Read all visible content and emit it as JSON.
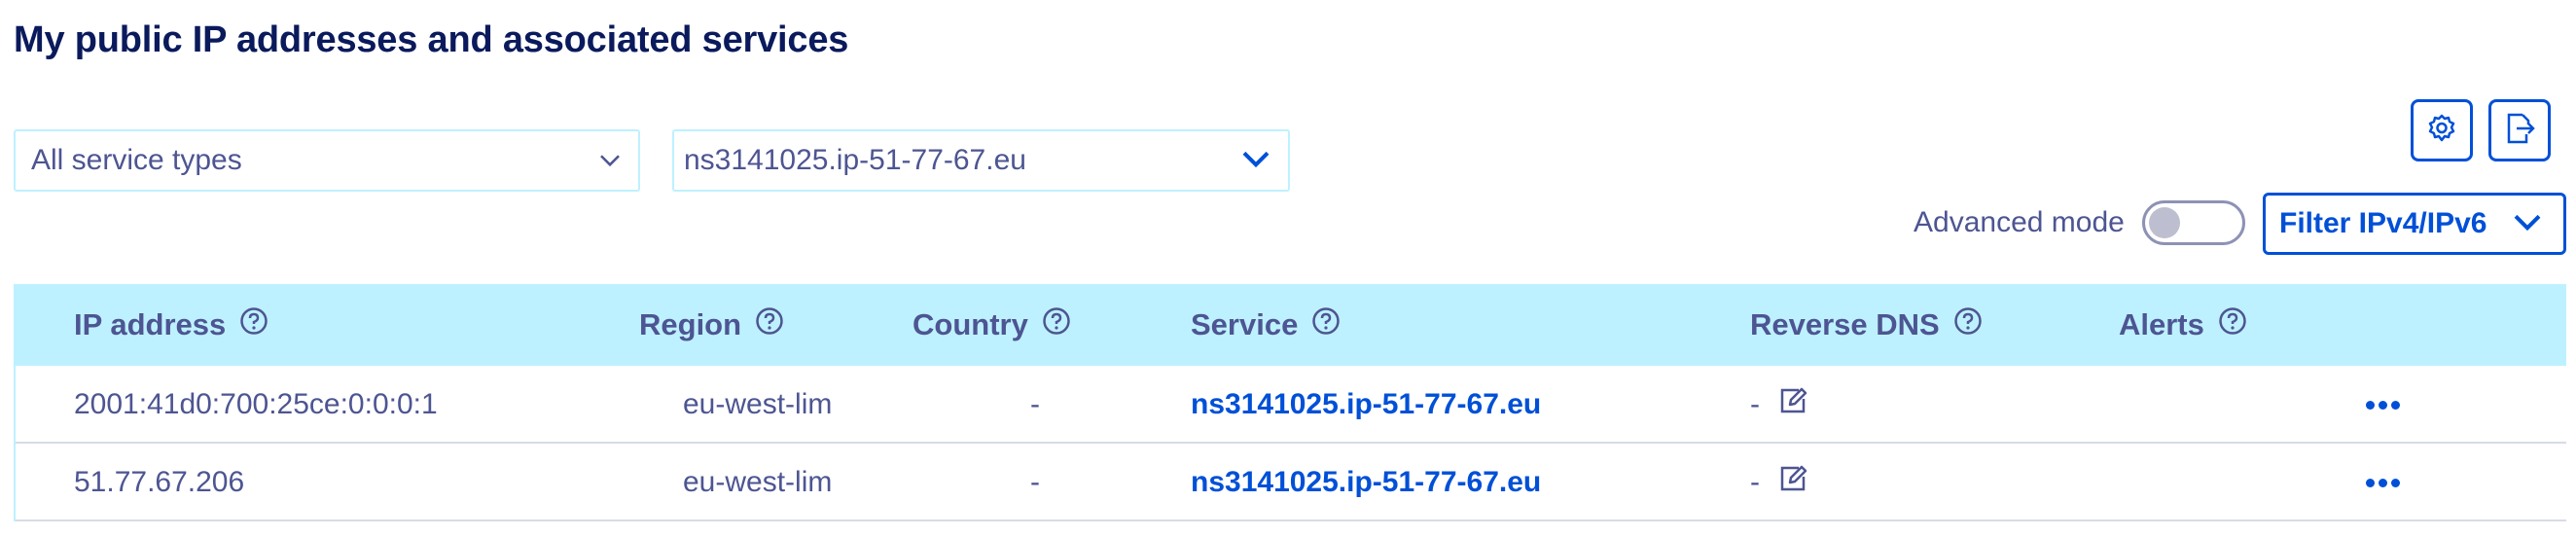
{
  "page": {
    "title": "My public IP addresses and associated services"
  },
  "filters": {
    "service_type": {
      "value": "All service types",
      "icon": "chevron-down-icon"
    },
    "service": {
      "value": "ns3141025.ip-51-77-67.eu",
      "icon": "chevron-down-icon"
    }
  },
  "toolbar": {
    "settings_icon": "gear-icon",
    "export_icon": "export-icon",
    "advanced_mode_label": "Advanced mode",
    "advanced_mode_on": false,
    "filter_ip_label": "Filter IPv4/IPv6"
  },
  "table": {
    "columns": [
      {
        "label": "IP address"
      },
      {
        "label": "Region"
      },
      {
        "label": "Country"
      },
      {
        "label": "Service"
      },
      {
        "label": "Reverse DNS"
      },
      {
        "label": "Alerts"
      }
    ],
    "rows": [
      {
        "ip": "2001:41d0:700:25ce:0:0:0:1",
        "region": "eu-west-lim",
        "country": "-",
        "service": "ns3141025.ip-51-77-67.eu",
        "reverse_dns": "-",
        "alerts": ""
      },
      {
        "ip": "51.77.67.206",
        "region": "eu-west-lim",
        "country": "-",
        "service": "ns3141025.ip-51-77-67.eu",
        "reverse_dns": "-",
        "alerts": ""
      }
    ]
  },
  "colors": {
    "accent": "#0050d7",
    "header_bg": "#bef1ff",
    "text": "#4d5592",
    "title": "#0a1a5c"
  }
}
